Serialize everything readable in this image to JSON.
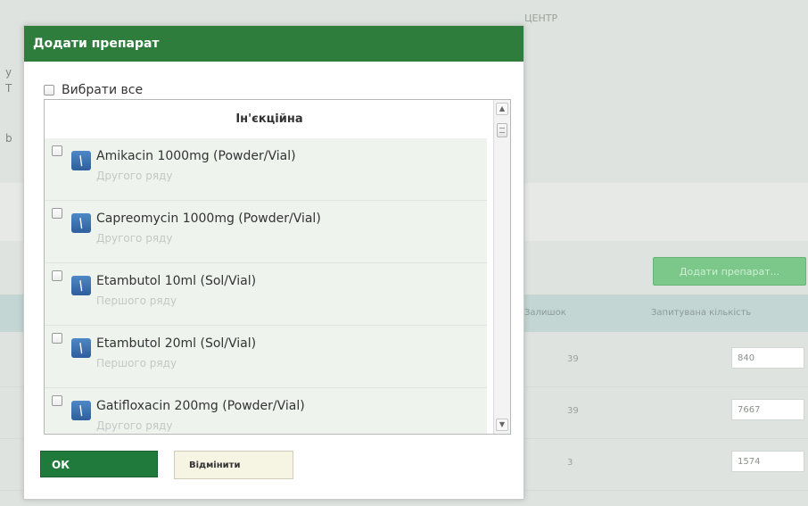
{
  "background": {
    "title": "ЦЕНТР",
    "add_button_label": "Додати препарат...",
    "table_columns": [
      "Залишок",
      "Запитувана кількість"
    ],
    "rows": [
      {
        "count": "39",
        "quantity": "840"
      },
      {
        "count": "39",
        "quantity": "7667"
      },
      {
        "count": "3",
        "quantity": "1574"
      }
    ]
  },
  "modal": {
    "title": "Додати препарат",
    "select_all_label": "Вибрати все",
    "group_label": "Ін'єкційна",
    "items": [
      {
        "name": "Amikacin 1000mg (Powder/Vial)",
        "subtitle": "Другого ряду"
      },
      {
        "name": "Capreomycin 1000mg (Powder/Vial)",
        "subtitle": "Другого ряду"
      },
      {
        "name": "Etambutol 10ml (Sol/Vial)",
        "subtitle": "Першого ряду"
      },
      {
        "name": "Etambutol 20ml (Sol/Vial)",
        "subtitle": "Першого ряду"
      },
      {
        "name": "Gatifloxacin 200mg (Powder/Vial)",
        "subtitle": "Другого ряду"
      }
    ],
    "ok_label": "ОК",
    "cancel_label": "Відмінити"
  },
  "colors": {
    "header_green": "#2e7d3c",
    "ok_green": "#1f7a3c",
    "add_button_green": "#7cc88a",
    "table_header": "#c3d6d4",
    "item_background": "#eef3ee"
  },
  "icons": {
    "drug_icon": "syringe-icon",
    "scroll_up": "arrow-up-icon",
    "scroll_down": "arrow-down-icon"
  }
}
